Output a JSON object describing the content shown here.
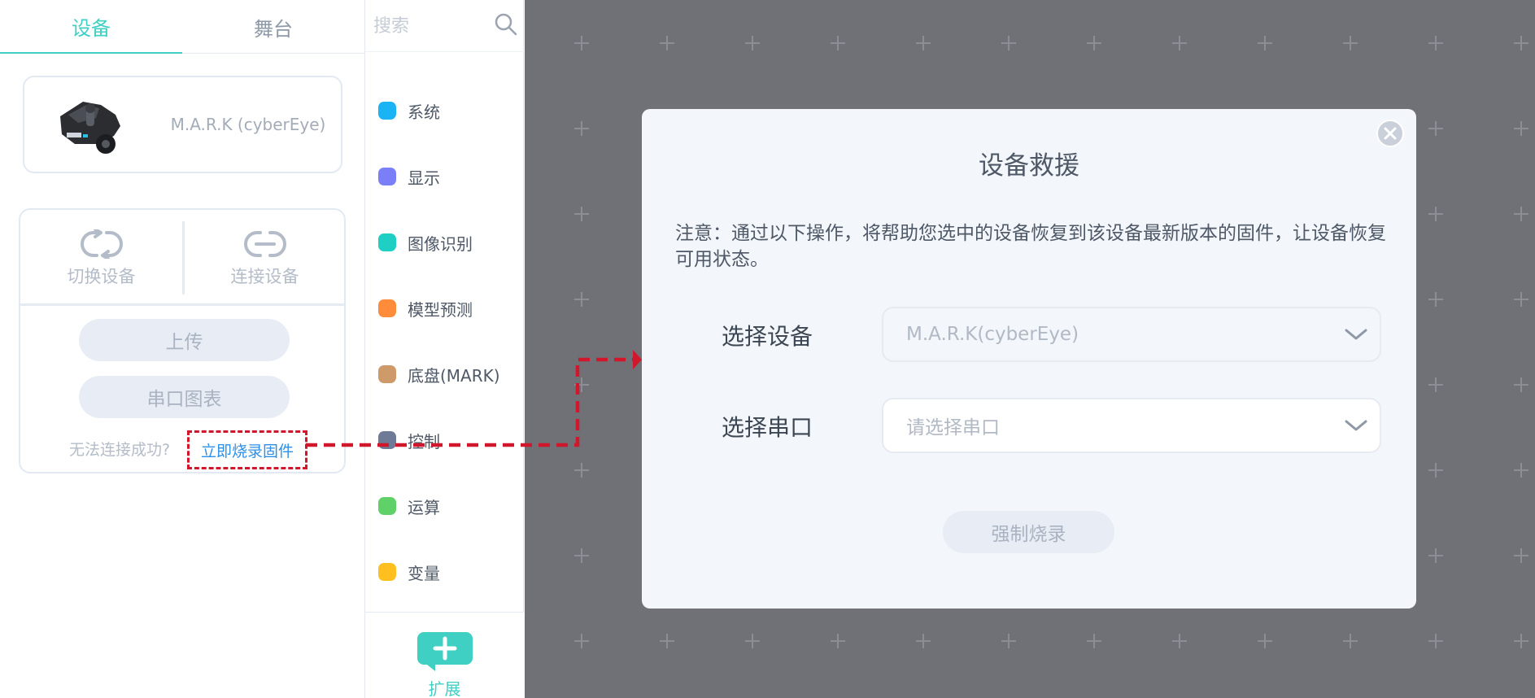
{
  "tabs": {
    "device": "设备",
    "stage": "舞台"
  },
  "device_card": {
    "name": "M.A.R.K (cyberEye)"
  },
  "actions": {
    "switch_device": "切换设备",
    "connect_device": "连接设备",
    "upload": "上传",
    "serial_chart": "串口图表",
    "help_text": "无法连接成功?",
    "flash_link": "立即烧录固件"
  },
  "search": {
    "placeholder": "搜索"
  },
  "categories": [
    {
      "label": "系统",
      "color": "#1ab4f5"
    },
    {
      "label": "显示",
      "color": "#7b7ff7"
    },
    {
      "label": "图像识别",
      "color": "#1fcfc3"
    },
    {
      "label": "模型预测",
      "color": "#ff8c3a"
    },
    {
      "label": "底盘(MARK)",
      "color": "#cf9a6a"
    },
    {
      "label": "控制",
      "color": "#6f7b96"
    },
    {
      "label": "运算",
      "color": "#5fd168"
    },
    {
      "label": "变量",
      "color": "#ffbf1f"
    },
    {
      "label": "",
      "color": "#a070f0"
    }
  ],
  "extension": {
    "label": "扩展",
    "color": "#3fcfc3"
  },
  "modal": {
    "title": "设备救援",
    "note": "注意：通过以下操作，将帮助您选中的设备恢复到该设备最新版本的固件，让设备恢复可用状态。",
    "device_label": "选择设备",
    "device_value": "M.A.R.K(cyberEye)",
    "port_label": "选择串口",
    "port_placeholder": "请选择串口",
    "force_flash": "强制烧录"
  },
  "colors": {
    "accent": "#3fcfc3",
    "annotation": "#d0172b",
    "link": "#2d8fe8",
    "workspace": "#77797e"
  }
}
